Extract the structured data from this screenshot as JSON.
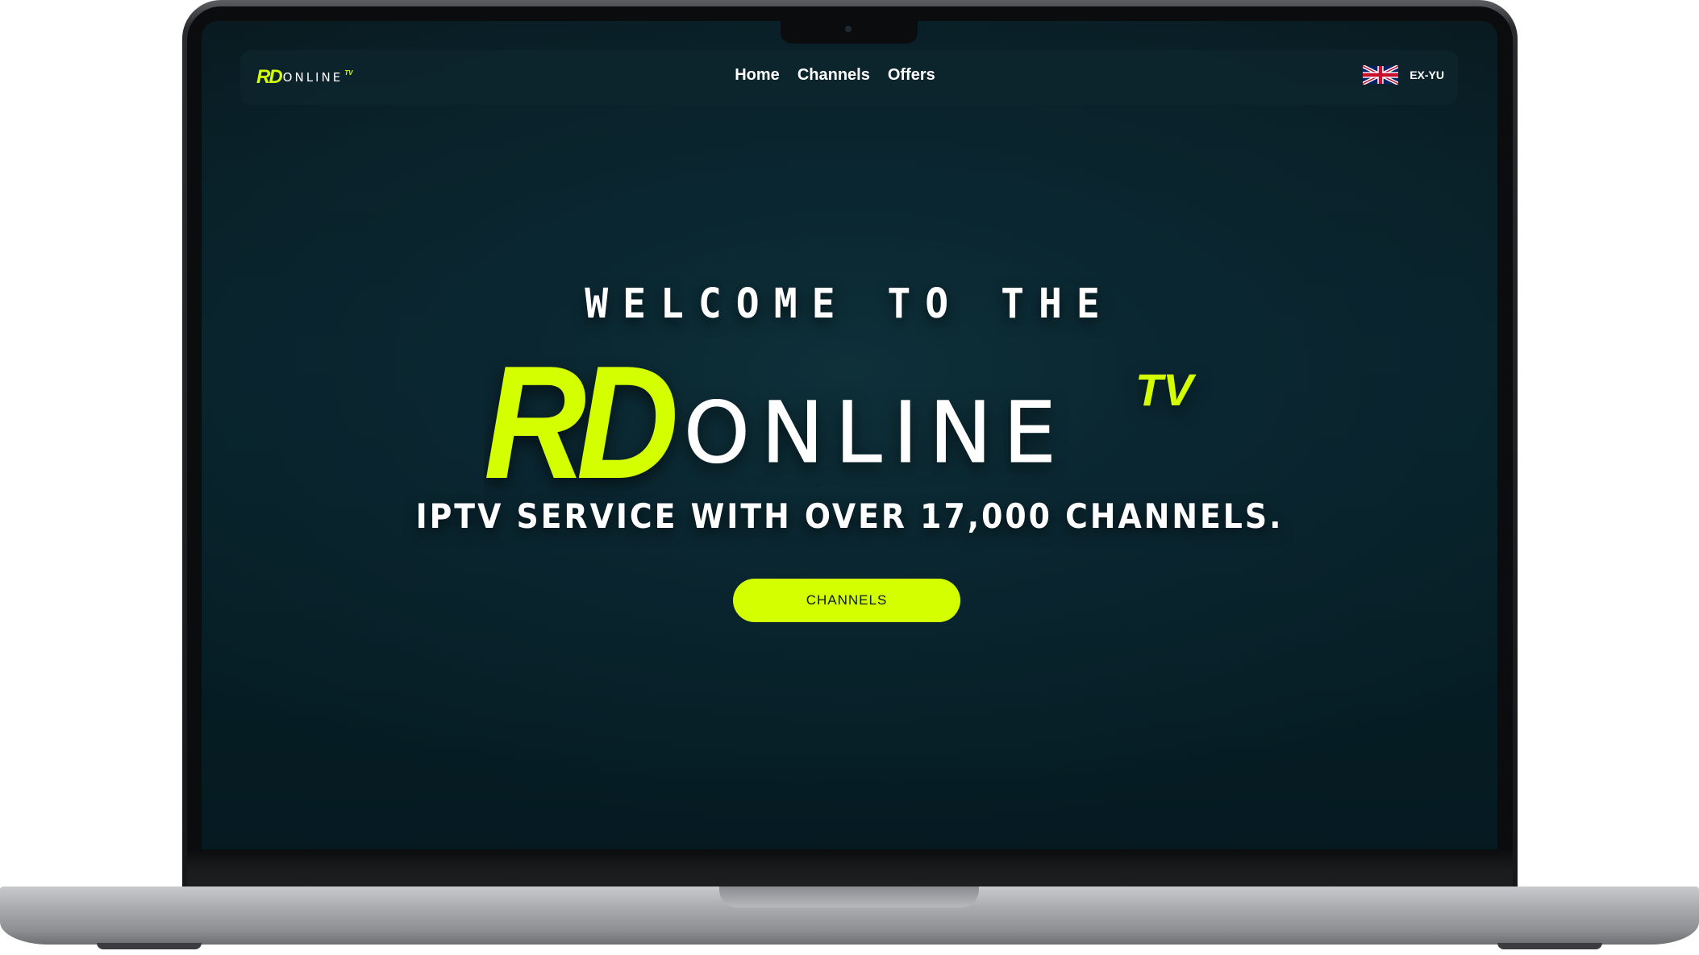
{
  "nav": {
    "logo_rd": "RD",
    "logo_online": "ONLINE",
    "logo_tv": "TV",
    "links": [
      "Home",
      "Channels",
      "Offers"
    ],
    "language_label": "EX-YU",
    "language_flag": "uk-flag-icon"
  },
  "hero": {
    "welcome": "WELCOME TO THE",
    "logo_rd": "RD",
    "logo_online": "ONLINE",
    "logo_tv": "TV",
    "subtitle": "IPTV SERVICE WITH OVER 17,000 CHANNELS.",
    "cta_label": "CHANNELS"
  },
  "colors": {
    "accent": "#d4ff00",
    "background": "#08222a",
    "text": "#ffffff"
  }
}
